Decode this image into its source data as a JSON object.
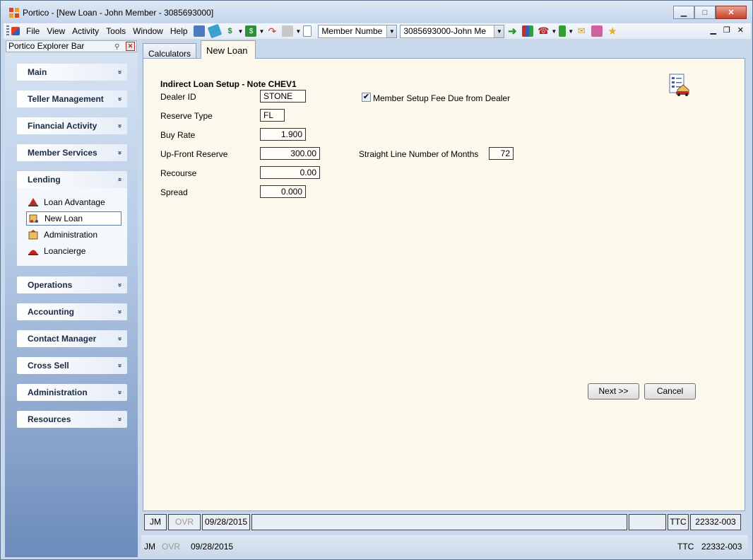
{
  "window": {
    "title": "Portico - [New Loan - John Member - 3085693000]",
    "controls": {
      "minimize": "▁",
      "maximize": "□",
      "close": "✕"
    }
  },
  "menubar": {
    "items": [
      "File",
      "View",
      "Activity",
      "Tools",
      "Window",
      "Help"
    ]
  },
  "toolbar": {
    "search_type": "Member Numbe",
    "member_combo": "3085693000-John Me",
    "mdi_controls": {
      "minimize": "▁",
      "restore": "❐",
      "close": "✕"
    }
  },
  "explorer": {
    "title": "Portico Explorer Bar",
    "groups": [
      {
        "label": "Main",
        "chevron": "»"
      },
      {
        "label": "Teller Management",
        "chevron": "»"
      },
      {
        "label": "Financial Activity",
        "chevron": "»"
      },
      {
        "label": "Member Services",
        "chevron": "»"
      },
      {
        "label": "Lending",
        "chevron": "«"
      },
      {
        "label": "Operations",
        "chevron": "»"
      },
      {
        "label": "Accounting",
        "chevron": "»"
      },
      {
        "label": "Contact Manager",
        "chevron": "»"
      },
      {
        "label": "Cross Sell",
        "chevron": "»"
      },
      {
        "label": "Administration",
        "chevron": "»"
      },
      {
        "label": "Resources",
        "chevron": "»"
      }
    ],
    "lending_items": [
      {
        "label": "Loan Advantage",
        "icon": "loan-advantage-icon"
      },
      {
        "label": "New Loan",
        "icon": "new-loan-icon",
        "selected": true
      },
      {
        "label": "Administration",
        "icon": "administration-icon"
      },
      {
        "label": "Loancierge",
        "icon": "loancierge-icon"
      }
    ]
  },
  "tabs": [
    {
      "label": "Calculators",
      "active": false
    },
    {
      "label": "New Loan",
      "active": true
    }
  ],
  "form": {
    "title": "Indirect Loan Setup - Note CHEV1",
    "dealer_id": {
      "label": "Dealer ID",
      "value": "STONE"
    },
    "reserve_type": {
      "label": "Reserve Type",
      "value": "FL"
    },
    "buy_rate": {
      "label": "Buy Rate",
      "value": "1.900"
    },
    "up_front_reserve": {
      "label": "Up-Front Reserve",
      "value": "300.00"
    },
    "recourse": {
      "label": "Recourse",
      "value": "0.00"
    },
    "spread": {
      "label": "Spread",
      "value": "0.000"
    },
    "member_setup_fee": {
      "label": "Member Setup Fee Due from Dealer",
      "checked": true
    },
    "straight_line_months": {
      "label": "Straight Line Number of Months",
      "value": "72"
    },
    "next_label": "Next >>",
    "cancel_label": "Cancel"
  },
  "statusbar_inner": {
    "user": "JM",
    "ovr": "OVR",
    "date": "09/28/2015",
    "ttc": "TTC",
    "branch": "22332-003"
  },
  "statusbar_outer": {
    "user": "JM",
    "ovr": "OVR",
    "date": "09/28/2015",
    "ttc": "TTC",
    "branch": "22332-003"
  },
  "colors": {
    "form_background": "#fdf8ec",
    "explorer_gradient_top": "#d6e3f3",
    "explorer_gradient_bottom": "#6c8bbb"
  }
}
